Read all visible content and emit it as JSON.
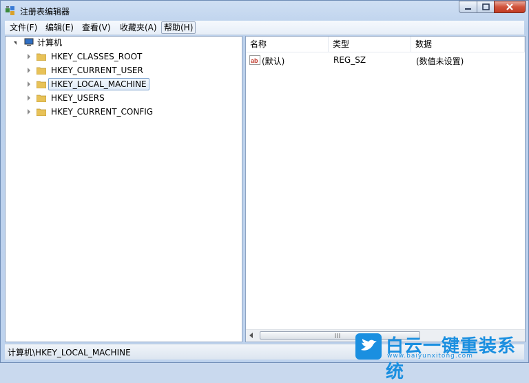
{
  "window": {
    "title": "注册表编辑器"
  },
  "menu": [
    "文件(F)",
    "编辑(E)",
    "查看(V)",
    "收藏夹(A)",
    "帮助(H)"
  ],
  "tree": {
    "root": "计算机",
    "keys": [
      "HKEY_CLASSES_ROOT",
      "HKEY_CURRENT_USER",
      "HKEY_LOCAL_MACHINE",
      "HKEY_USERS",
      "HKEY_CURRENT_CONFIG"
    ],
    "selected": "HKEY_LOCAL_MACHINE"
  },
  "list": {
    "columns": [
      "名称",
      "类型",
      "数据"
    ],
    "rows": [
      {
        "name": "(默认)",
        "type": "REG_SZ",
        "data": "(数值未设置)"
      }
    ]
  },
  "status": {
    "path": "计算机\\HKEY_LOCAL_MACHINE"
  },
  "watermark": {
    "title": "白云一键重装系统",
    "url": "www.baiyunxitong.com"
  },
  "colors": {
    "accent": "#1a8fe0",
    "folder": "#e8c258",
    "close": "#c33c24"
  }
}
